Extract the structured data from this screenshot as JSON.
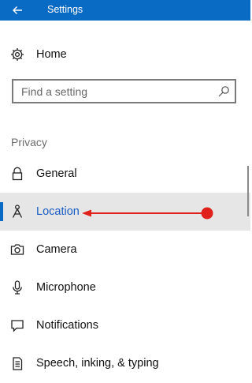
{
  "window": {
    "title": "Settings",
    "accent_color": "#0a6bc4",
    "back_icon": "back-arrow-icon"
  },
  "home": {
    "label": "Home",
    "icon": "gear-icon"
  },
  "search": {
    "placeholder": "Find a setting",
    "value": "",
    "icon": "search-icon"
  },
  "sidebar": {
    "section_title": "Privacy",
    "selected_index": 1,
    "items": [
      {
        "label": "General",
        "icon": "lock-icon"
      },
      {
        "label": "Location",
        "icon": "location-person-icon"
      },
      {
        "label": "Camera",
        "icon": "camera-icon"
      },
      {
        "label": "Microphone",
        "icon": "microphone-icon"
      },
      {
        "label": "Notifications",
        "icon": "notification-icon"
      },
      {
        "label": "Speech, inking, & typing",
        "icon": "speech-icon"
      }
    ]
  },
  "annotation": {
    "type": "red-arrow",
    "points_to": "Location",
    "color": "#e0201b"
  }
}
